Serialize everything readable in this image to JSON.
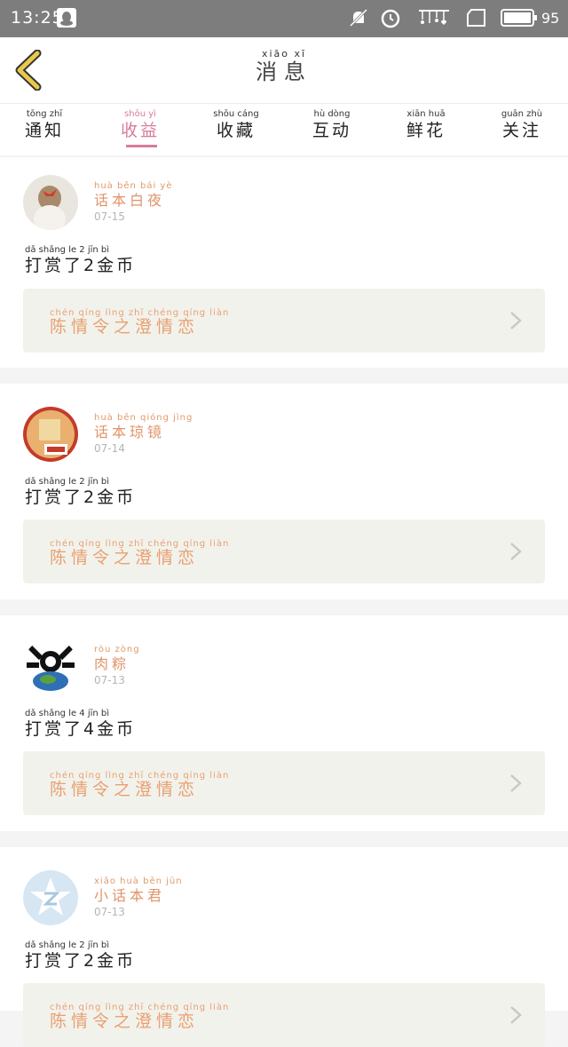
{
  "status_bar": {
    "time": "13:25",
    "battery": "95",
    "icons": [
      "qq-icon",
      "mute-icon",
      "alarm-icon",
      "signal-icon",
      "sim-icon",
      "battery-icon"
    ]
  },
  "header": {
    "title_pinyin": "xiāo xī",
    "title": "消息",
    "back_icon": "chevron-left-icon",
    "accent": "#e8c94a"
  },
  "tabs": [
    {
      "pinyin": "tōng zhī",
      "label": "通知"
    },
    {
      "pinyin": "shōu yì",
      "label": "收益",
      "active": true
    },
    {
      "pinyin": "shōu cáng",
      "label": "收藏"
    },
    {
      "pinyin": "hù dòng",
      "label": "互动"
    },
    {
      "pinyin": "xiān huā",
      "label": "鲜花"
    },
    {
      "pinyin": "guān zhù",
      "label": "关注"
    }
  ],
  "active_color": "#d97a9e",
  "items": [
    {
      "name_pinyin": "huà běn bái yè",
      "name": "话本白夜",
      "date": "07-15",
      "action_pinyin": "dǎ shǎng le 2 jīn bì",
      "action": "打赏了2金币",
      "work_pinyin": "chén qíng lìng zhī chéng qíng liàn",
      "work": "陈情令之澄情恋"
    },
    {
      "name_pinyin": "huà běn qióng jìng",
      "name": "话本琼镜",
      "date": "07-14",
      "action_pinyin": "dǎ shǎng le 2 jīn bì",
      "action": "打赏了2金币",
      "work_pinyin": "chén qíng lìng zhī chéng qíng liàn",
      "work": "陈情令之澄情恋"
    },
    {
      "name_pinyin": "ròu zòng",
      "name": "肉粽",
      "date": "07-13",
      "action_pinyin": "dǎ shǎng le 4 jīn bì",
      "action": "打赏了4金币",
      "work_pinyin": "chén qíng lìng zhī chéng qíng liàn",
      "work": "陈情令之澄情恋"
    },
    {
      "name_pinyin": "xiǎo huà běn jūn",
      "name": "小话本君",
      "date": "07-13",
      "action_pinyin": "dǎ shǎng le 2 jīn bì",
      "action": "打赏了2金币",
      "work_pinyin": "chén qíng lìng zhī chéng qíng liàn",
      "work": "陈情令之澄情恋"
    }
  ]
}
